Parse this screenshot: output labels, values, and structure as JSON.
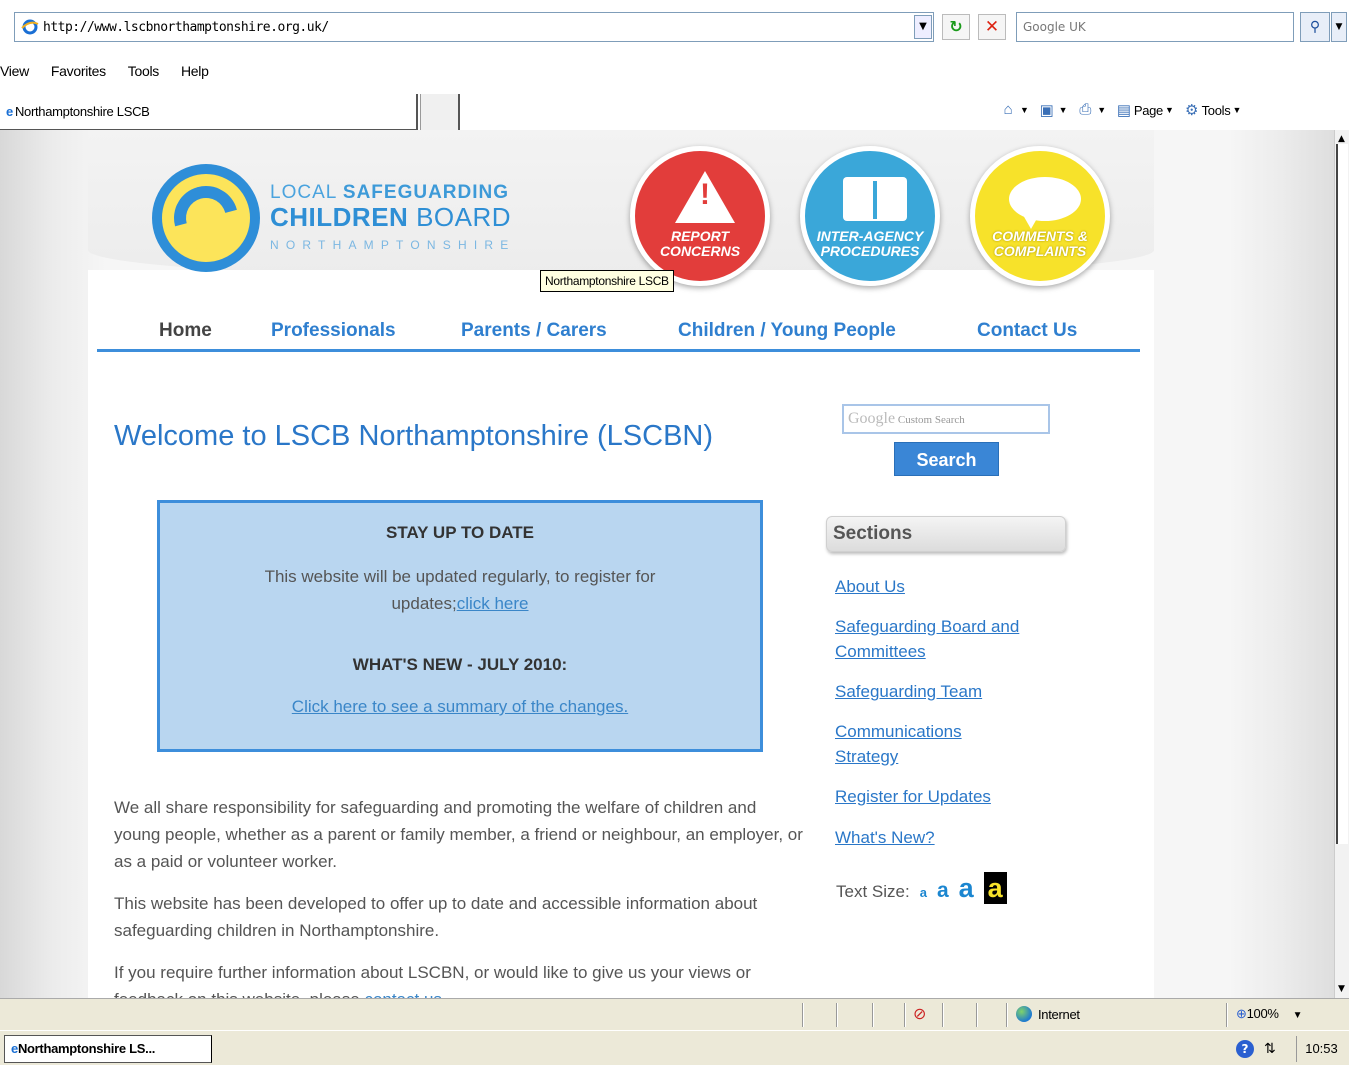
{
  "browser": {
    "url": "http://www.lscbnorthamptonshire.org.uk/",
    "search_engine": "Google UK",
    "menu": [
      "View",
      "Favorites",
      "Tools",
      "Help"
    ],
    "tab_title": "Northamptonshire LSCB",
    "command_bar": {
      "page_label": "Page",
      "tools_label": "Tools"
    },
    "status": {
      "zone": "Internet",
      "zoom": "100%"
    },
    "taskbar": {
      "task_label": "Northamptonshire LS...",
      "clock": "10:53"
    }
  },
  "page": {
    "logo": {
      "line1_light": "LOCAL ",
      "line1_bold": "SAFEGUARDING",
      "line2_bold": "CHILDREN ",
      "line2_light": "BOARD",
      "line3": "NORTHAMPTONSHIRE"
    },
    "badges": {
      "report": "REPORT CONCERNS",
      "procedures": "INTER-AGENCY PROCEDURES",
      "comments": "COMMENTS & COMPLAINTS"
    },
    "tooltip": "Northamptonshire LSCB",
    "nav": {
      "home": "Home",
      "professionals": "Professionals",
      "parents": "Parents / Carers",
      "children": "Children / Young People",
      "contact": "Contact Us"
    },
    "welcome": "Welcome to LSCB Northamptonshire (LSCBN)",
    "update_box": {
      "stay_title": "STAY UP TO DATE",
      "stay_text": "This website will be updated regularly, to register for updates;",
      "stay_link": "click here",
      "new_title": "WHAT'S NEW - JULY 2010:",
      "new_link": "Click here to see a summary of the changes."
    },
    "paragraphs": {
      "p1": "We all share responsibility for safeguarding and promoting the welfare of children and young people, whether as a parent or family member, a friend or neighbour, an employer, or as a paid or volunteer worker.",
      "p2": "This website has been developed to offer up to date and accessible information about safeguarding children in Northamptonshire.",
      "p3": "If you require further information about LSCBN, or would like to give us your views or feedback on this website, please ",
      "p3_link": "contact us"
    },
    "search": {
      "google_word": "Google",
      "placeholder": "Custom Search",
      "button": "Search"
    },
    "sections": {
      "title": "Sections",
      "links": [
        "About Us",
        "Safeguarding Board and Committees",
        "Safeguarding Team",
        "Communications Strategy",
        "Register for Updates",
        "What's New?"
      ]
    },
    "text_size": {
      "label": "Text Size:",
      "options": [
        "a",
        "a",
        "a",
        "a"
      ]
    }
  },
  "colors": {
    "link_blue": "#2a77c8",
    "nav_rule": "#3d8edb",
    "report_red": "#e23d3b",
    "procedures_blue": "#3aa7d9",
    "comments_yellow": "#f7e22a",
    "box_fill": "#b9d6f0"
  }
}
